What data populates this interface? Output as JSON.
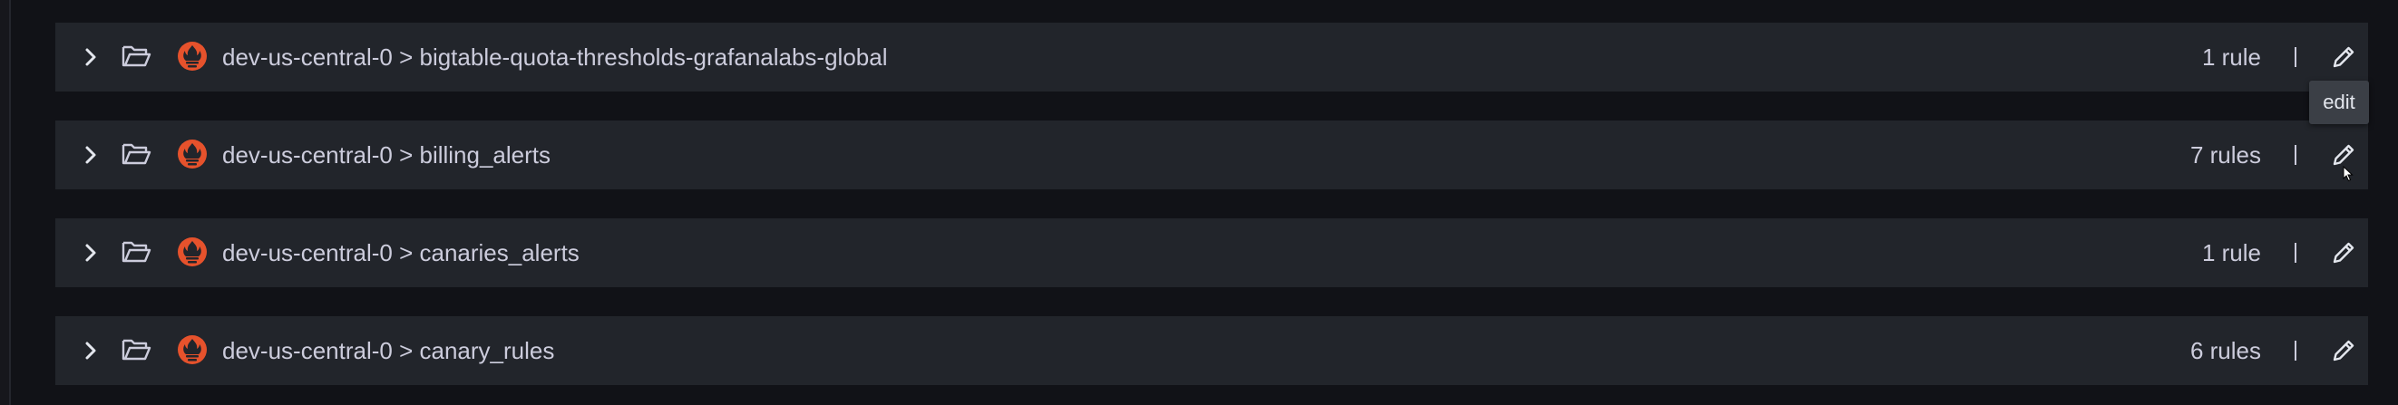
{
  "colors": {
    "background": "#111217",
    "row_background": "#22252b",
    "text": "#ccccdc",
    "prometheus_icon": "#e6522c",
    "tooltip_background": "#3b3f46"
  },
  "rules_list": {
    "groups": [
      {
        "namespace": "dev-us-central-0",
        "separator": ">",
        "title": "dev-us-central-0 > bigtable-quota-thresholds-grafanalabs-global",
        "rule_count": "1 rule",
        "expand_icon": "chevron-right-icon",
        "folder_icon": "folder-open-icon",
        "datasource_icon": "prometheus-icon",
        "edit_icon": "pencil-icon"
      },
      {
        "namespace": "dev-us-central-0",
        "separator": ">",
        "title": "dev-us-central-0 > billing_alerts",
        "rule_count": "7 rules",
        "expand_icon": "chevron-right-icon",
        "folder_icon": "folder-open-icon",
        "datasource_icon": "prometheus-icon",
        "edit_icon": "pencil-icon"
      },
      {
        "namespace": "dev-us-central-0",
        "separator": ">",
        "title": "dev-us-central-0 > canaries_alerts",
        "rule_count": "1 rule",
        "expand_icon": "chevron-right-icon",
        "folder_icon": "folder-open-icon",
        "datasource_icon": "prometheus-icon",
        "edit_icon": "pencil-icon"
      },
      {
        "namespace": "dev-us-central-0",
        "separator": ">",
        "title": "dev-us-central-0 > canary_rules",
        "rule_count": "6 rules",
        "expand_icon": "chevron-right-icon",
        "folder_icon": "folder-open-icon",
        "datasource_icon": "prometheus-icon",
        "edit_icon": "pencil-icon"
      }
    ]
  },
  "tooltip": {
    "text": "edit"
  }
}
